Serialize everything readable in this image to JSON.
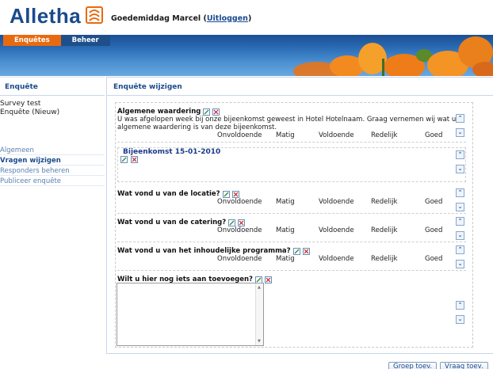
{
  "app": {
    "logo": "Alletha",
    "greeting_prefix": "Goedemiddag Marcel (",
    "logout_label": "Uitloggen",
    "greeting_suffix": ")"
  },
  "tabs": [
    {
      "label": "Enquêtes",
      "active": true
    },
    {
      "label": "Beheer",
      "active": false
    }
  ],
  "sidebar": {
    "heading": "Enquête",
    "survey_name": "Survey test",
    "survey_status": "Enquête (Nieuw)",
    "items": [
      {
        "label": "Algemeen",
        "active": false
      },
      {
        "label": "Vragen wijzigen",
        "active": true
      },
      {
        "label": "Responders beheren",
        "active": false
      },
      {
        "label": "Publiceer enquête",
        "active": false
      }
    ]
  },
  "main": {
    "heading": "Enquête wijzigen",
    "scale": [
      "Onvoldoende",
      "Matig",
      "Voldoende",
      "Redelijk",
      "Goed"
    ],
    "q1": {
      "title": "Algemene waardering",
      "description": "U was afgelopen week bij onze bijeenkomst geweest in Hotel Hotelnaam. Graag vernemen wij wat uw algemene waardering is van deze bijeenkomst."
    },
    "group": {
      "title": "Bijeenkomst 15-01-2010"
    },
    "q2": {
      "title": "Wat vond u van de locatie?"
    },
    "q3": {
      "title": "Wat vond u van de catering?"
    },
    "q4": {
      "title": "Wat vond u van het inhoudelijke programma?"
    },
    "q5": {
      "title": "Wilt u hier nog iets aan toevoegen?"
    }
  },
  "buttons": {
    "group_add": "Groep toev.",
    "question_add": "Vraag toev."
  },
  "colors": {
    "brand_blue": "#1a4a8e",
    "tab_orange": "#e86a10",
    "link_blue": "#5a7fb0"
  }
}
